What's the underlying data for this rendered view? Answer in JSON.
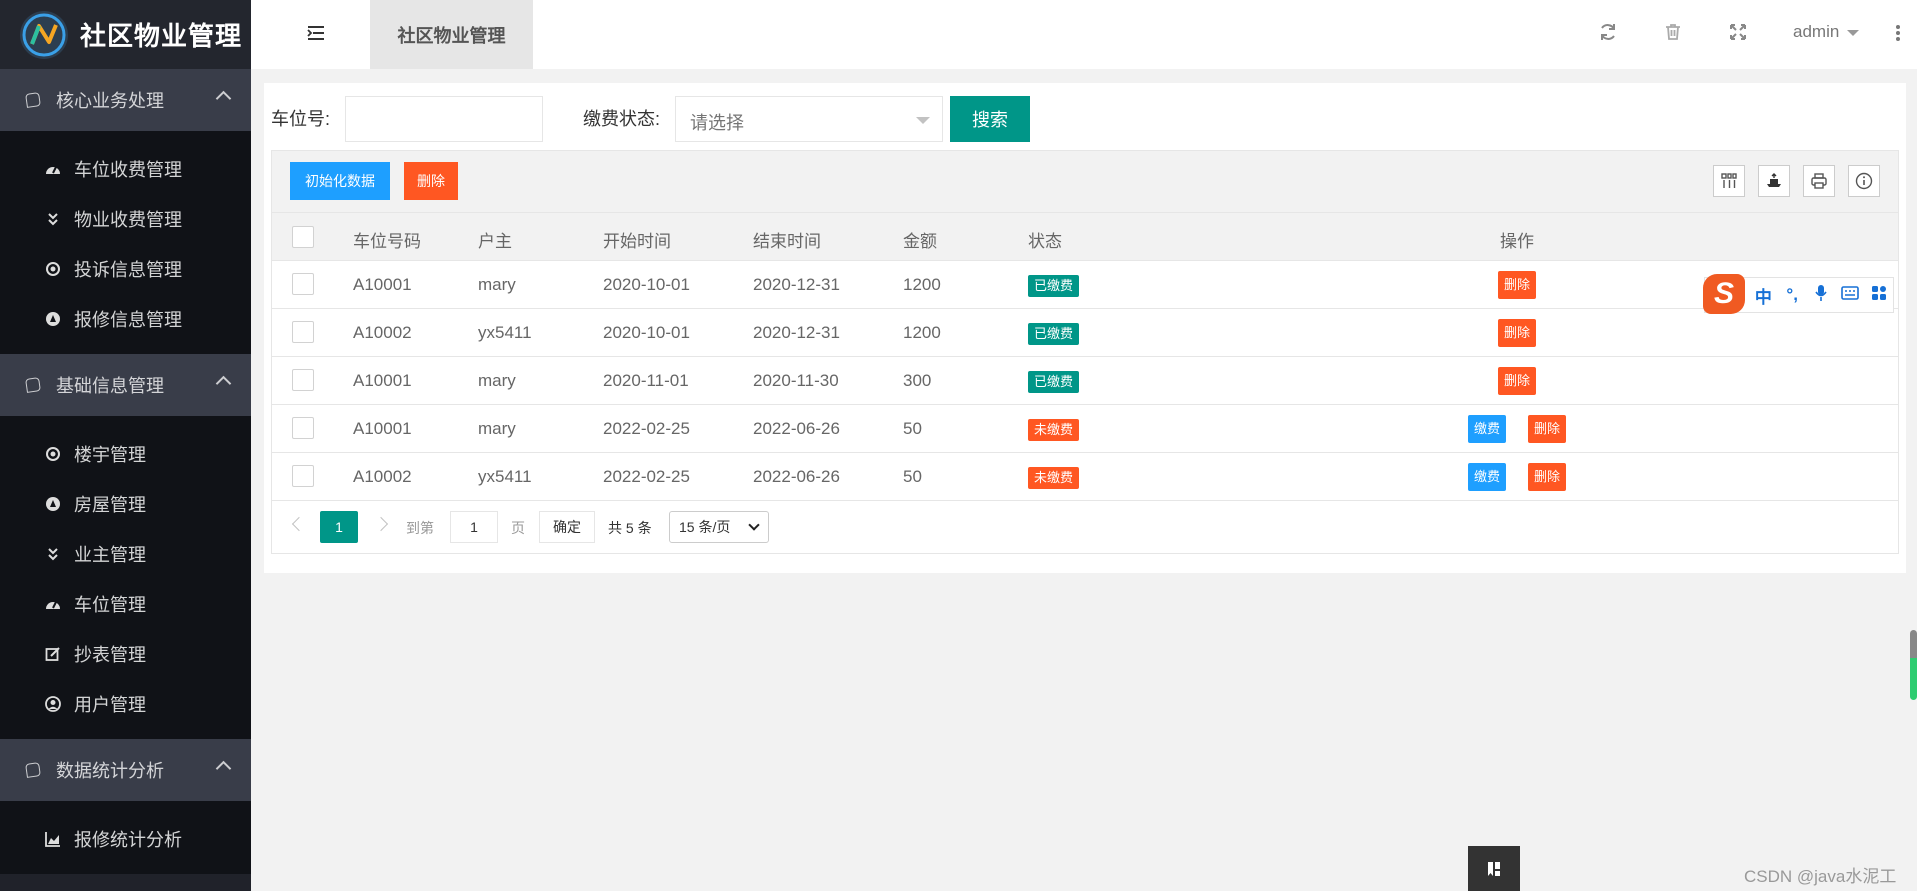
{
  "app": {
    "title": "社区物业管理"
  },
  "sidebar": {
    "groups": [
      {
        "label": "核心业务处理",
        "items": [
          {
            "label": "车位收费管理",
            "icon": "dashboard-icon"
          },
          {
            "label": "物业收费管理",
            "icon": "double-chevron-down-icon"
          },
          {
            "label": "投诉信息管理",
            "icon": "target-icon"
          },
          {
            "label": "报修信息管理",
            "icon": "compass-icon"
          }
        ]
      },
      {
        "label": "基础信息管理",
        "items": [
          {
            "label": "楼宇管理",
            "icon": "target-icon"
          },
          {
            "label": "房屋管理",
            "icon": "compass-icon"
          },
          {
            "label": "业主管理",
            "icon": "double-chevron-down-icon"
          },
          {
            "label": "车位管理",
            "icon": "dashboard-icon"
          },
          {
            "label": "抄表管理",
            "icon": "edit-icon"
          },
          {
            "label": "用户管理",
            "icon": "user-circle-icon"
          }
        ]
      },
      {
        "label": "数据统计分析",
        "items": [
          {
            "label": "报修统计分析",
            "icon": "area-chart-icon"
          }
        ]
      }
    ]
  },
  "header": {
    "tab_label": "社区物业管理",
    "user": "admin"
  },
  "search": {
    "plate_label": "车位号:",
    "plate_value": "",
    "status_label": "缴费状态:",
    "status_placeholder": "请选择",
    "search_button": "搜索"
  },
  "toolbar": {
    "init_button": "初始化数据",
    "delete_button": "删除"
  },
  "table": {
    "columns": [
      "车位号码",
      "户主",
      "开始时间",
      "结束时间",
      "金额",
      "状态",
      "操作"
    ],
    "rows": [
      {
        "code": "A10001",
        "owner": "mary",
        "start": "2020-10-01",
        "end": "2020-12-31",
        "amount": "1200",
        "status": "已缴费",
        "paid": true
      },
      {
        "code": "A10002",
        "owner": "yx5411",
        "start": "2020-10-01",
        "end": "2020-12-31",
        "amount": "1200",
        "status": "已缴费",
        "paid": true
      },
      {
        "code": "A10001",
        "owner": "mary",
        "start": "2020-11-01",
        "end": "2020-11-30",
        "amount": "300",
        "status": "已缴费",
        "paid": true
      },
      {
        "code": "A10001",
        "owner": "mary",
        "start": "2022-02-25",
        "end": "2022-06-26",
        "amount": "50",
        "status": "未缴费",
        "paid": false
      },
      {
        "code": "A10002",
        "owner": "yx5411",
        "start": "2022-02-25",
        "end": "2022-06-26",
        "amount": "50",
        "status": "未缴费",
        "paid": false
      }
    ],
    "pay_label": "缴费",
    "delete_label": "删除"
  },
  "pager": {
    "current_page": "1",
    "goto_label": "到第",
    "goto_value": "1",
    "page_suffix": "页",
    "confirm": "确定",
    "total": "共 5 条",
    "page_size": "15 条/页"
  },
  "ime": {
    "logo": "S",
    "mode": "中",
    "punct": "°,"
  },
  "watermark": "CSDN @java水泥工",
  "colors": {
    "primary": "#009688",
    "danger": "#ff5722",
    "info": "#1e9fff",
    "sidebar": "#20222a"
  }
}
